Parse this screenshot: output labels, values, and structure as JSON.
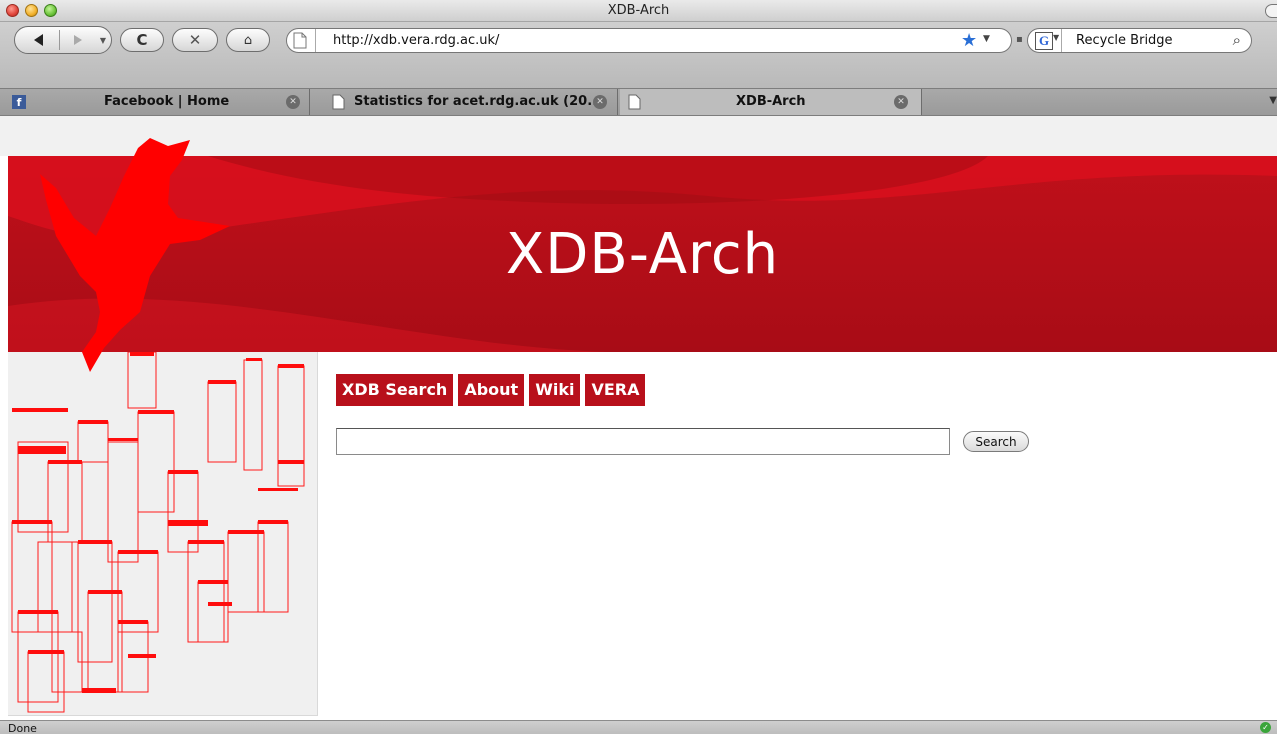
{
  "window": {
    "title": "XDB-Arch"
  },
  "toolbar": {
    "url": "http://xdb.vera.rdg.ac.uk/",
    "search_text": "Recycle Bridge"
  },
  "tabs": [
    {
      "label": "Facebook | Home",
      "icon": "facebook-icon"
    },
    {
      "label": "Statistics for acet.rdg.ac.uk (20...",
      "icon": "page-icon"
    },
    {
      "label": "XDB-Arch",
      "icon": "page-icon",
      "active": true
    }
  ],
  "page": {
    "site_title": "XDB-Arch",
    "nav": [
      "XDB Search",
      "About",
      "Wiki",
      "VERA"
    ],
    "search_button": "Search",
    "search_value": ""
  },
  "status": {
    "text": "Done"
  },
  "colors": {
    "banner_red": "#b8101b",
    "nav_red": "#b8101b",
    "dove_red": "#ff0000"
  }
}
